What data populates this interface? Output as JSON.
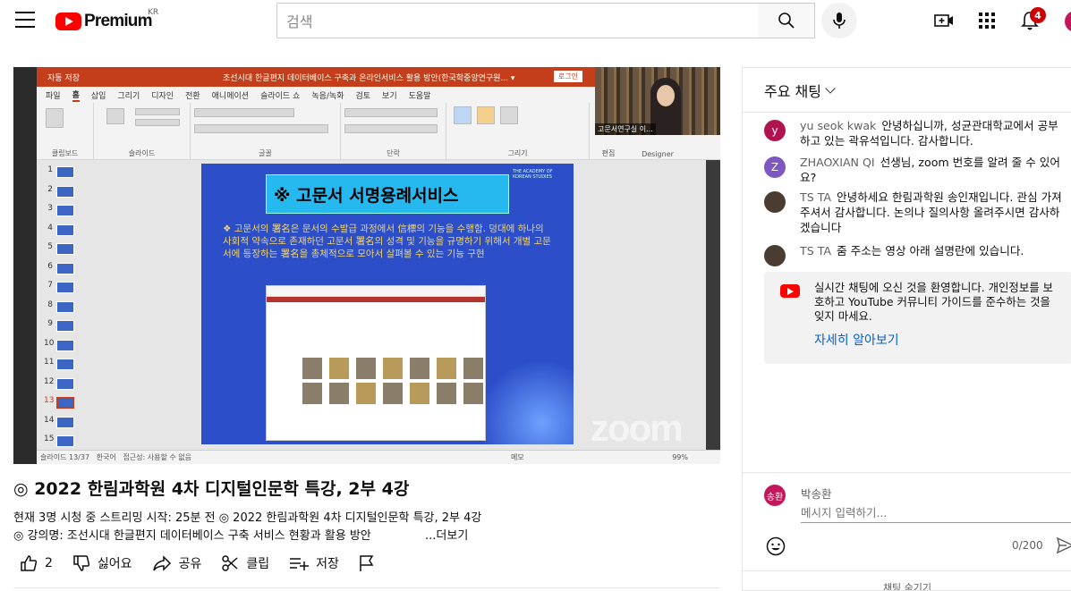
{
  "header": {
    "logo_text": "Premium",
    "logo_region": "KR",
    "search_placeholder": "검색",
    "notification_count": "4",
    "brand_color": "#ff0000"
  },
  "player": {
    "ppt_title": "조선시대 한글편지 데이터베이스 구축과 온라인서비스 활용 방안(한국학중앙연구원... ▾",
    "ppt_autosave": "자동 저장",
    "ppt_login": "로그인",
    "ppt_menu": [
      "파일",
      "홈",
      "삽입",
      "그리기",
      "디자인",
      "전환",
      "애니메이션",
      "슬라이드 쇼",
      "녹음/녹화",
      "검토",
      "보기",
      "도움말"
    ],
    "ribbon_groups": [
      "클립보드",
      "슬라이드",
      "글꼴",
      "단락",
      "그리기",
      "편집",
      "Designer"
    ],
    "thumb_numbers": [
      "1",
      "2",
      "3",
      "4",
      "5",
      "6",
      "7",
      "8",
      "9",
      "10",
      "11",
      "12",
      "13",
      "14",
      "15"
    ],
    "slide_title": "※ 고문서 서명용례서비스",
    "slide_org": "THE ACADEMY OF KOREAN STUDIES",
    "slide_body": "❖ 고문서의 署名은 문서의 수발급 과정에서 信標의 기능을 수행함. 덩대에 하나의 사회적 약속으로 존재하던 고문서 署名의 성격 및 기능을 규명하기 위해서 개별 고문서에 등장하는 署名을 총체적으로 모아서 살펴볼 수 있는 기능 구현",
    "zoom_watermark": "zoom",
    "status_slide": "슬라이드 13/37",
    "status_lang": "한국어",
    "status_access": "접근성: 사용할 수 없음",
    "status_notes": "메모",
    "status_zoom": "99%",
    "webcam_label": "고문서연구실 이..."
  },
  "video": {
    "title": "◎ 2022 한림과학원 4차 디지털인문학 특강, 2부 4강",
    "meta": "현재 3명 시청 중  스트리밍 시작: 25분 전  ◎ 2022 한림과학원 4차 디지털인문학 특강, 2부 4강",
    "desc": "◎ 강의명: 조선시대 한글편지 데이터베이스 구축 서비스 현황과 활용 방안",
    "more": "...더보기",
    "like_count": "2",
    "dislike_label": "싫어요",
    "share_label": "공유",
    "clip_label": "클립",
    "save_label": "저장"
  },
  "chat": {
    "header": "주요 채팅",
    "messages": [
      {
        "avatar": "y",
        "color": "#b0144f",
        "author": "yu seok kwak",
        "text": "안녕하십니까, 성균관대학교에서 공부하고 있는 곽유석입니다. 감사합니다."
      },
      {
        "avatar": "Z",
        "color": "#7e57c2",
        "author": "ZHAOXIAN QI",
        "text": "선생님, zoom 번호를 알려 줄 수 있어요?"
      },
      {
        "avatar": "",
        "color": "#5d4a3a",
        "author": "TS TA",
        "text": "안녕하세요 한림과학원 송인재입니다. 관심 가져주셔서 감사합니다. 논의나 질의사항 올려주시면 감사하겠습니다"
      },
      {
        "avatar": "",
        "color": "#5d4a3a",
        "author": "TS TA",
        "text": "줌 주소는 영상 아래 설명란에 있습니다."
      }
    ],
    "banner_text": "실시간 채팅에 오신 것을 환영합니다. 개인정보를 보호하고 YouTube 커뮤니티 가이드를 준수하는 것을 잊지 마세요.",
    "banner_link": "자세히 알아보기",
    "composer_avatar": "송환",
    "composer_name": "박송환",
    "composer_placeholder": "메시지 입력하기...",
    "counter": "0/200",
    "hide_chat": "채팅 숨기기"
  }
}
